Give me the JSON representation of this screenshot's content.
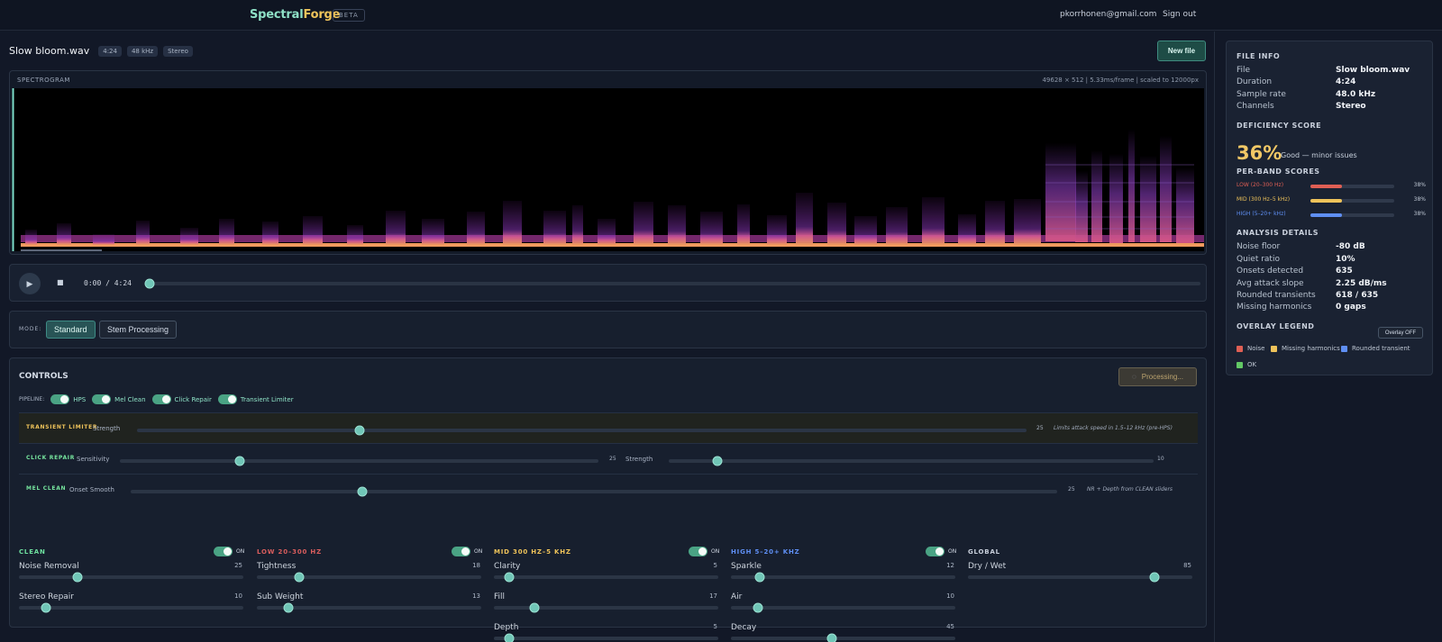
{
  "app": {
    "name_part1": "Spectral",
    "name_part2": "Forge",
    "badge": "BETA",
    "email": "pkorrhonen@gmail.com",
    "sign_out": "Sign out"
  },
  "file": {
    "name": "Slow bloom.wav",
    "tags": [
      "4:24",
      "48 kHz",
      "Stereo"
    ],
    "new_file": "New file"
  },
  "spectrogram": {
    "label": "SPECTROGRAM",
    "meta": "49628 × 512 | 5.33ms/frame | scaled to 12000px"
  },
  "transport": {
    "play_icon": "▶",
    "stop_icon": "■",
    "time": "0:00 / 4:24",
    "progress": 0
  },
  "mode": {
    "label": "MODE:",
    "options": [
      "Standard",
      "Stem Processing"
    ],
    "selected": "Standard"
  },
  "controls": {
    "title": "CONTROLS",
    "processing": "Processing...",
    "pipeline_label": "PIPELINE:",
    "pipeline": [
      {
        "label": "HPS",
        "on": true
      },
      {
        "label": "Mel Clean",
        "on": true
      },
      {
        "label": "Click Repair",
        "on": true
      },
      {
        "label": "Transient Limiter",
        "on": true
      }
    ],
    "transient": {
      "name": "TRANSIENT LIMITER",
      "param": "Strength",
      "value": "25",
      "note": "Limits attack speed in 1.5–12 kHz (pre-HPS)",
      "level": 0.25
    },
    "click": {
      "name": "CLICK REPAIR",
      "sensitivity": "Sensitivity",
      "sensitivity_value": "25",
      "sensitivity_level": 0.25,
      "strength": "Strength",
      "strength_value": "10",
      "strength_level": 0.1
    },
    "mel": {
      "name": "MEL CLEAN",
      "param": "Onset Smooth",
      "value": "25",
      "note": "NR + Depth from CLEAN sliders",
      "level": 0.25
    },
    "bands": [
      {
        "title": "CLEAN",
        "color": "#6ee09f",
        "on": "ON",
        "controls": [
          {
            "name": "Noise Removal",
            "value": "25",
            "level": 0.26
          },
          {
            "name": "Stereo Repair",
            "value": "10",
            "level": 0.12
          }
        ]
      },
      {
        "title": "LOW 20–300 HZ",
        "color": "#d95d5d",
        "on": "ON",
        "controls": [
          {
            "name": "Tightness",
            "value": "18",
            "level": 0.19
          },
          {
            "name": "Sub Weight",
            "value": "13",
            "level": 0.14
          }
        ]
      },
      {
        "title": "MID 300 HZ–5 KHZ",
        "color": "#efc35a",
        "on": "ON",
        "controls": [
          {
            "name": "Clarity",
            "value": "5",
            "level": 0.07
          },
          {
            "name": "Fill",
            "value": "17",
            "level": 0.18
          },
          {
            "name": "Depth",
            "value": "5",
            "level": 0.07
          }
        ]
      },
      {
        "title": "HIGH 5–20+ KHZ",
        "color": "#5f8ff4",
        "on": "ON",
        "controls": [
          {
            "name": "Sparkle",
            "value": "12",
            "level": 0.13
          },
          {
            "name": "Air",
            "value": "10",
            "level": 0.12
          },
          {
            "name": "Decay",
            "value": "45",
            "level": 0.45
          }
        ]
      },
      {
        "title": "GLOBAL",
        "color": "#c9d0dc",
        "controls": [
          {
            "name": "Dry / Wet",
            "value": "85",
            "level": 0.83
          }
        ]
      }
    ]
  },
  "sidebar": {
    "file_info": "FILE INFO",
    "info": [
      {
        "k": "File",
        "v": "Slow bloom.wav"
      },
      {
        "k": "Duration",
        "v": "4:24"
      },
      {
        "k": "Sample rate",
        "v": "48.0 kHz"
      },
      {
        "k": "Channels",
        "v": "Stereo"
      }
    ],
    "deficiency": "DEFICIENCY SCORE",
    "score": "36%",
    "score_text": "Good — minor issues",
    "per_band": "PER-BAND SCORES",
    "bands": [
      {
        "name": "LOW (20–300 Hz)",
        "value": "38%",
        "level": 0.38,
        "color": "#df5f54"
      },
      {
        "name": "MID (300 Hz–5 kHz)",
        "value": "38%",
        "level": 0.38,
        "color": "#efc35a"
      },
      {
        "name": "HIGH (5–20+ kHz)",
        "value": "38%",
        "level": 0.38,
        "color": "#5f8ff4"
      }
    ],
    "analysis": "ANALYSIS DETAILS",
    "details": [
      {
        "k": "Noise floor",
        "v": "-80 dB"
      },
      {
        "k": "Quiet ratio",
        "v": "10%"
      },
      {
        "k": "Onsets detected",
        "v": "635"
      },
      {
        "k": "Avg attack slope",
        "v": "2.25 dB/ms"
      },
      {
        "k": "Rounded transients",
        "v": "618 / 635"
      },
      {
        "k": "Missing harmonics",
        "v": "0 gaps"
      }
    ],
    "legend_title": "OVERLAY LEGEND",
    "overlay": "Overlay OFF",
    "legend": [
      {
        "label": "Noise",
        "color": "#df5f54"
      },
      {
        "label": "Missing harmonics",
        "color": "#efc35a"
      },
      {
        "label": "Rounded transient",
        "color": "#5f8ff4"
      },
      {
        "label": "OK",
        "color": "#62c865"
      }
    ]
  }
}
